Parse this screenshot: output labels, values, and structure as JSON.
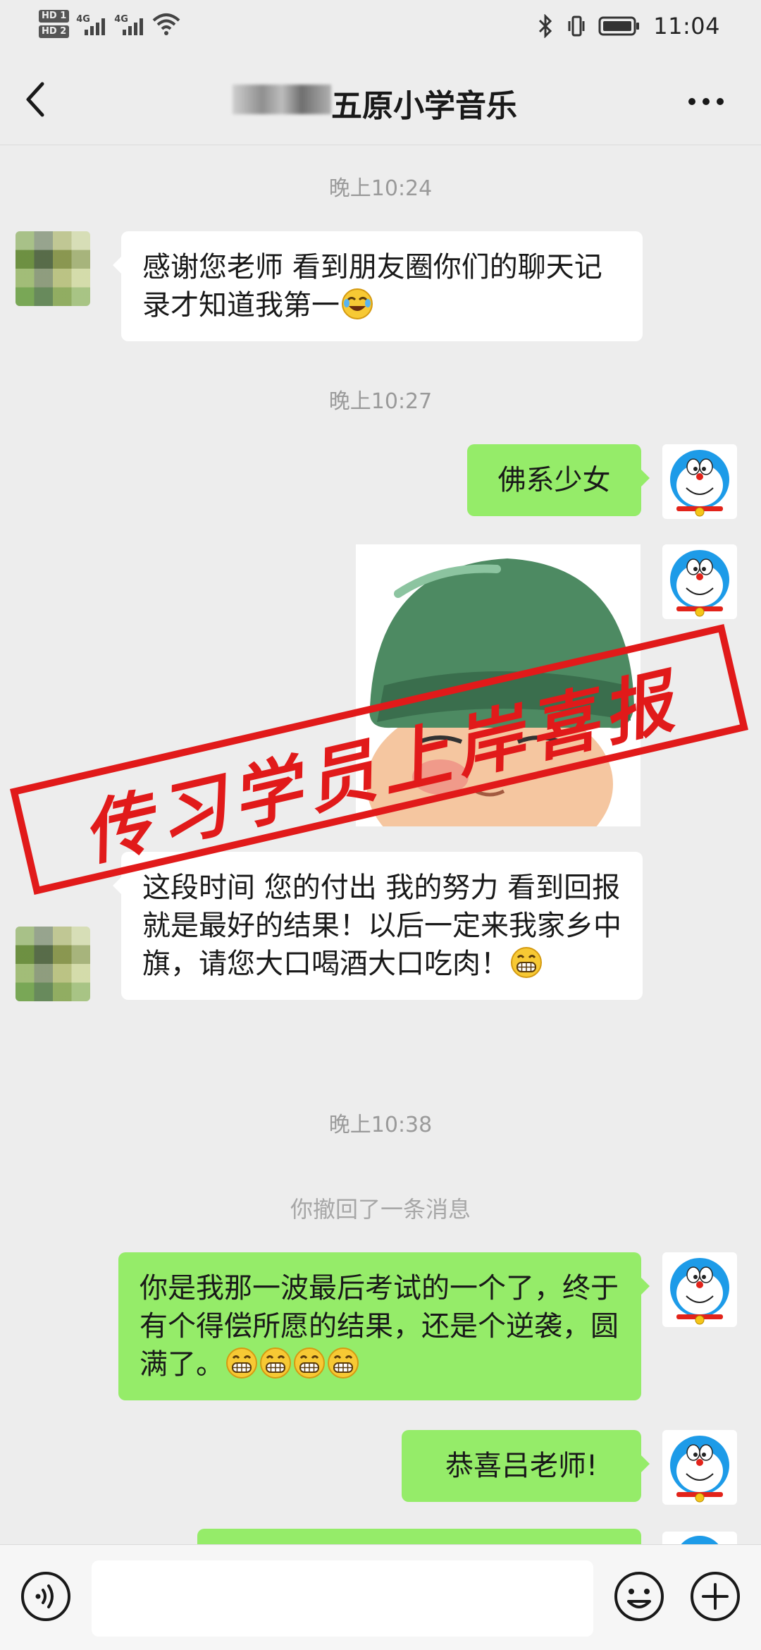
{
  "status_bar": {
    "hd1": "HD 1",
    "hd2": "HD 2",
    "net1": "4G",
    "net2": "4G",
    "time": "11:04"
  },
  "header": {
    "title": "五原小学音乐"
  },
  "messages": {
    "ts1": "晚上10:24",
    "msg1": "感谢您老师 看到朋友圈你们的聊天记录才知道我第一",
    "ts2": "晚上10:27",
    "msg2": "佛系少女",
    "msg3": "这段时间 您的付出 我的努力 看到回报就是最好的结果！以后一定来我家乡中旗，请您大口喝酒大口吃肉！",
    "ts3": "晚上10:38",
    "recall": "你撤回了一条消息",
    "msg4": "你是我那一波最后考试的一个了，终于有个得偿所愿的结果，还是个逆袭，圆满了。",
    "msg5": "恭喜吕老师!"
  },
  "stamp": {
    "text": "传习学员上岸喜报"
  },
  "colors": {
    "bubble_self": "#95ec69",
    "bubble_other": "#ffffff",
    "stamp_red": "#e11a1a",
    "background": "#ededed"
  },
  "icons": [
    "back-icon",
    "more-icon",
    "voice-icon",
    "emoji-icon",
    "plus-icon",
    "bluetooth-icon",
    "wifi-icon",
    "battery-icon"
  ]
}
